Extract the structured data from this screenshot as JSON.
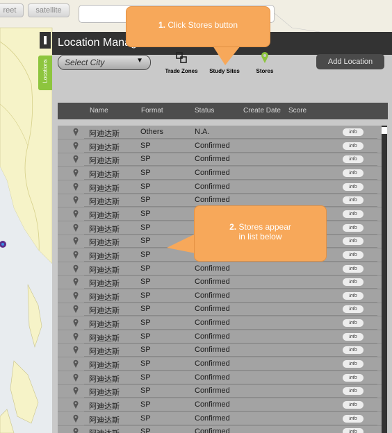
{
  "map": {
    "street_label": "reet",
    "satellite_label": "satellite"
  },
  "panel": {
    "title": "Location Manager",
    "side_tab_label": "Locations",
    "select_city": "Select City",
    "tools": [
      {
        "label": "Trade Zones",
        "icon": "trade-zones-icon"
      },
      {
        "label": "Study Sites",
        "icon": "map-pin-icon"
      },
      {
        "label": "Stores",
        "icon": "map-pin-icon",
        "color": "#8dc53e"
      }
    ],
    "add_location": "Add Location",
    "columns": [
      "Name",
      "Format",
      "Status",
      "Create Date",
      "Score"
    ]
  },
  "rows": [
    {
      "name": "阿迪达斯",
      "format": "Others",
      "status": "N.A.",
      "info": "info"
    },
    {
      "name": "阿迪达斯",
      "format": "SP",
      "status": "Confirmed",
      "info": "info"
    },
    {
      "name": "阿迪达斯",
      "format": "SP",
      "status": "Confirmed",
      "info": "info"
    },
    {
      "name": "阿迪达斯",
      "format": "SP",
      "status": "Confirmed",
      "info": "info"
    },
    {
      "name": "阿迪达斯",
      "format": "SP",
      "status": "Confirmed",
      "info": "info"
    },
    {
      "name": "阿迪达斯",
      "format": "SP",
      "status": "Confirmed",
      "info": "info"
    },
    {
      "name": "阿迪达斯",
      "format": "SP",
      "status": "",
      "info": "info"
    },
    {
      "name": "阿迪达斯",
      "format": "SP",
      "status": "",
      "info": "info"
    },
    {
      "name": "阿迪达斯",
      "format": "SP",
      "status": "",
      "info": "info"
    },
    {
      "name": "阿迪达斯",
      "format": "SP",
      "status": "",
      "info": "info"
    },
    {
      "name": "阿迪达斯",
      "format": "SP",
      "status": "Confirmed",
      "info": "info"
    },
    {
      "name": "阿迪达斯",
      "format": "SP",
      "status": "Confirmed",
      "info": "info"
    },
    {
      "name": "阿迪达斯",
      "format": "SP",
      "status": "Confirmed",
      "info": "info"
    },
    {
      "name": "阿迪达斯",
      "format": "SP",
      "status": "Confirmed",
      "info": "info"
    },
    {
      "name": "阿迪达斯",
      "format": "SP",
      "status": "Confirmed",
      "info": "info"
    },
    {
      "name": "阿迪达斯",
      "format": "SP",
      "status": "Confirmed",
      "info": "info"
    },
    {
      "name": "阿迪达斯",
      "format": "SP",
      "status": "Confirmed",
      "info": "info"
    },
    {
      "name": "阿迪达斯",
      "format": "SP",
      "status": "Confirmed",
      "info": "info"
    },
    {
      "name": "阿迪达斯",
      "format": "SP",
      "status": "Confirmed",
      "info": "info"
    },
    {
      "name": "阿迪达斯",
      "format": "SP",
      "status": "Confirmed",
      "info": "info"
    },
    {
      "name": "阿迪达斯",
      "format": "SP",
      "status": "Confirmed",
      "info": "info"
    },
    {
      "name": "阿迪达斯",
      "format": "SP",
      "status": "Confirmed",
      "info": "info"
    },
    {
      "name": "阿迪达斯",
      "format": "SP",
      "status": "Confirmed",
      "info": "info"
    }
  ],
  "callouts": {
    "step1_number": "1.",
    "step1_text": "Click Stores button",
    "step2_number": "2.",
    "step2_line1": "Stores appear",
    "step2_line2": "in list below"
  }
}
